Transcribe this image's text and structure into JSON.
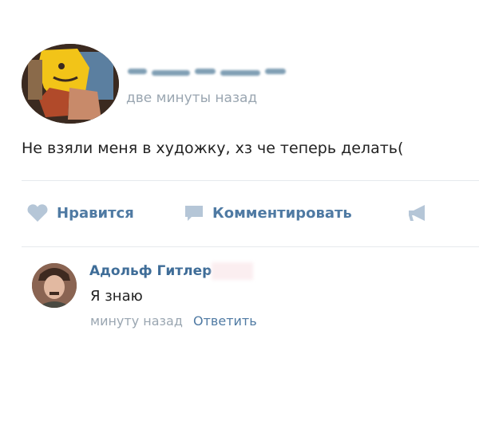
{
  "post": {
    "time": "две минуты назад",
    "text": "Не взяли меня в художку, хз че теперь делать("
  },
  "actions": {
    "like_label": "Нравится",
    "comment_label": "Комментировать",
    "like_icon": "heart-icon",
    "comment_icon": "comment-icon",
    "share_icon": "megaphone-icon"
  },
  "comment": {
    "author": "Адольф Гитлер",
    "text": "Я знаю",
    "time": "минуту назад",
    "reply_label": "Ответить"
  },
  "colors": {
    "link": "#4f7aa3",
    "muted": "#9aa6b1",
    "icon": "#b5c6d7"
  }
}
